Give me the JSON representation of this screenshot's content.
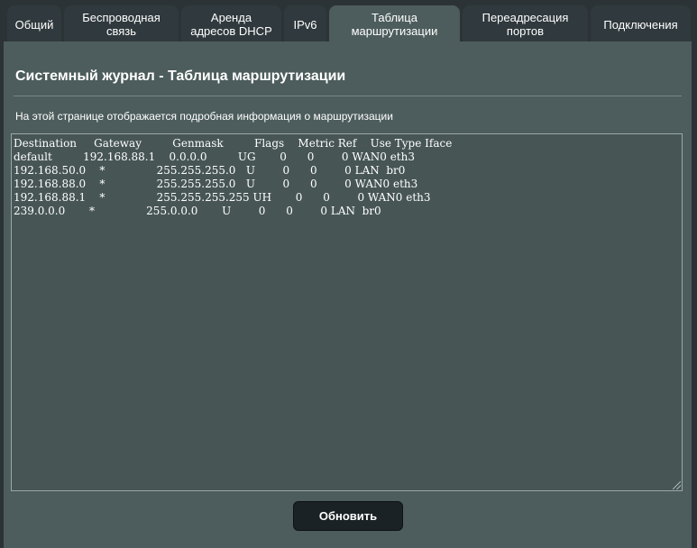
{
  "tabs": [
    {
      "label": "Общий"
    },
    {
      "label": "Беспроводная\nсвязь"
    },
    {
      "label": "Аренда\nадресов DHCP"
    },
    {
      "label": "IPv6"
    },
    {
      "label": "Таблица\nмаршрутизации"
    },
    {
      "label": "Переадресация\nпортов"
    },
    {
      "label": "Подключения"
    }
  ],
  "active_tab": "Таблица\nмаршрутизации",
  "page": {
    "title": "Системный журнал - Таблица маршрутизации",
    "description": "На этой странице отображается подробная информация о маршрутизации"
  },
  "routing_log": "Destination     Gateway         Genmask         Flags    Metric Ref    Use Type Iface\ndefault         192.168.88.1    0.0.0.0         UG       0      0        0 WAN0 eth3\n192.168.50.0    *               255.255.255.0   U        0      0        0 LAN  br0\n192.168.88.0    *               255.255.255.0   U        0      0        0 WAN0 eth3\n192.168.88.1    *               255.255.255.255 UH       0      0        0 WAN0 eth3\n239.0.0.0       *               255.0.0.0       U        0      0        0 LAN  br0",
  "buttons": {
    "refresh": "Обновить"
  },
  "colors": {
    "background": "#2c3336",
    "panel": "#4d5c5c",
    "tab_inactive": "#30393d",
    "button": "#1b2225"
  }
}
